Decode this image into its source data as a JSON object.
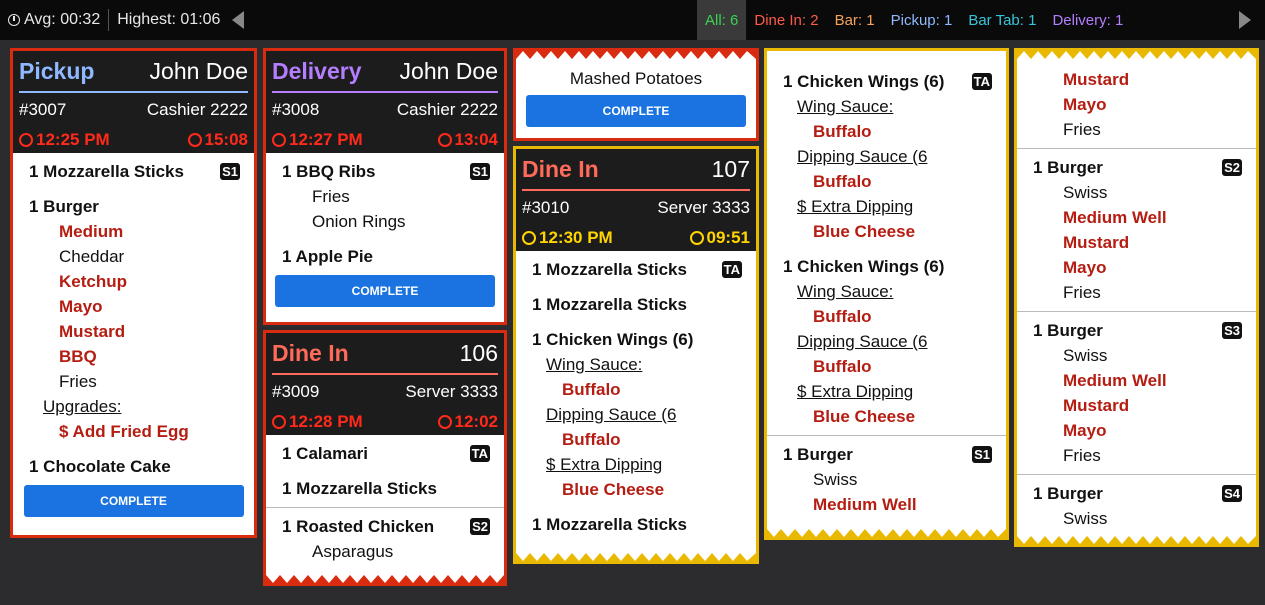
{
  "topbar": {
    "avg_label": "Avg:",
    "avg_value": "00:32",
    "highest_label": "Highest:",
    "highest_value": "01:06",
    "filters": [
      {
        "label": "All:",
        "count": "6",
        "color": "#39d353"
      },
      {
        "label": "Dine In:",
        "count": "2",
        "color": "#ff5a4a"
      },
      {
        "label": "Bar:",
        "count": "1",
        "color": "#f5a35c"
      },
      {
        "label": "Pickup:",
        "count": "1",
        "color": "#8fb8ff"
      },
      {
        "label": "Bar Tab:",
        "count": "1",
        "color": "#35c7d9"
      },
      {
        "label": "Delivery:",
        "count": "1",
        "color": "#b57dff"
      }
    ]
  },
  "colors": {
    "red_border": "#d92b10",
    "yellow_border": "#e8b900",
    "pickup": "#8fb8ff",
    "delivery": "#b57dff",
    "dine_in": "#ff6a5a",
    "modifier_red": "#b51d12",
    "complete_blue": "#1a73e0",
    "time_red": "#ff2a1a",
    "time_yellow": "#ffd400"
  },
  "complete_label": "COMPLETE",
  "t1": {
    "type": "Pickup",
    "name": "John Doe",
    "number": "#3007",
    "staff": "Cashier 2222",
    "time": "12:25 PM",
    "elapsed": "15:08",
    "i1": "1 Mozzarella Sticks",
    "i1_seat": "S1",
    "i2": "1 Burger",
    "m1": "Medium",
    "m2": "Cheddar",
    "m3": "Ketchup",
    "m4": "Mayo",
    "m5": "Mustard",
    "m6": "BBQ",
    "m7": "Fries",
    "m8": "Upgrades:",
    "m9": "$ Add Fried Egg",
    "i3": "1 Chocolate Cake"
  },
  "t2": {
    "type": "Delivery",
    "name": "John Doe",
    "number": "#3008",
    "staff": "Cashier 2222",
    "time": "12:27 PM",
    "elapsed": "13:04",
    "i1": "1 BBQ Ribs",
    "i1_seat": "S1",
    "m1": "Fries",
    "m2": "Onion Rings",
    "i2": "1 Apple Pie"
  },
  "t3": {
    "type": "Dine In",
    "table": "106",
    "number": "#3009",
    "staff": "Server 3333",
    "time": "12:28 PM",
    "elapsed": "12:02",
    "i1": "1 Calamari",
    "i1_seat": "TA",
    "i2": "1 Mozzarella Sticks",
    "i3": "1 Roasted Chicken",
    "i3_seat": "S2",
    "m1": "Asparagus"
  },
  "t4": {
    "item": "Mashed Potatoes"
  },
  "t5": {
    "type": "Dine In",
    "table": "107",
    "number": "#3010",
    "staff": "Server 3333",
    "time": "12:30 PM",
    "elapsed": "09:51",
    "i1": "1 Mozzarella Sticks",
    "i1_seat": "TA",
    "i2": "1 Mozzarella Sticks",
    "i3": "1 Chicken Wings (6)",
    "m1": "Wing Sauce:",
    "m2": "Buffalo",
    "m3": "Dipping Sauce (6",
    "m4": "Buffalo",
    "m5": "$ Extra Dipping",
    "m6": "Blue Cheese",
    "i4": "1 Mozzarella Sticks"
  },
  "t6": {
    "i1": "1 Chicken Wings (6)",
    "i1_seat": "TA",
    "m1": "Wing Sauce:",
    "m2": "Buffalo",
    "m3": "Dipping Sauce (6",
    "m4": "Buffalo",
    "m5": "$ Extra Dipping",
    "m6": "Blue Cheese",
    "i2": "1 Chicken Wings (6)",
    "n1": "Wing Sauce:",
    "n2": "Buffalo",
    "n3": "Dipping Sauce (6",
    "n4": "Buffalo",
    "n5": "$ Extra Dipping",
    "n6": "Blue Cheese",
    "i3": "1 Burger",
    "i3_seat": "S1",
    "p1": "Swiss",
    "p2": "Medium Well"
  },
  "t7": {
    "m1": "Mustard",
    "m2": "Mayo",
    "m3": "Fries",
    "i1": "1 Burger",
    "i1_seat": "S2",
    "n1": "Swiss",
    "n2": "Medium Well",
    "n3": "Mustard",
    "n4": "Mayo",
    "n5": "Fries",
    "i2": "1 Burger",
    "i2_seat": "S3",
    "p1": "Swiss",
    "p2": "Medium Well",
    "p3": "Mustard",
    "p4": "Mayo",
    "p5": "Fries",
    "i3": "1 Burger",
    "i3_seat": "S4",
    "q1": "Swiss"
  }
}
